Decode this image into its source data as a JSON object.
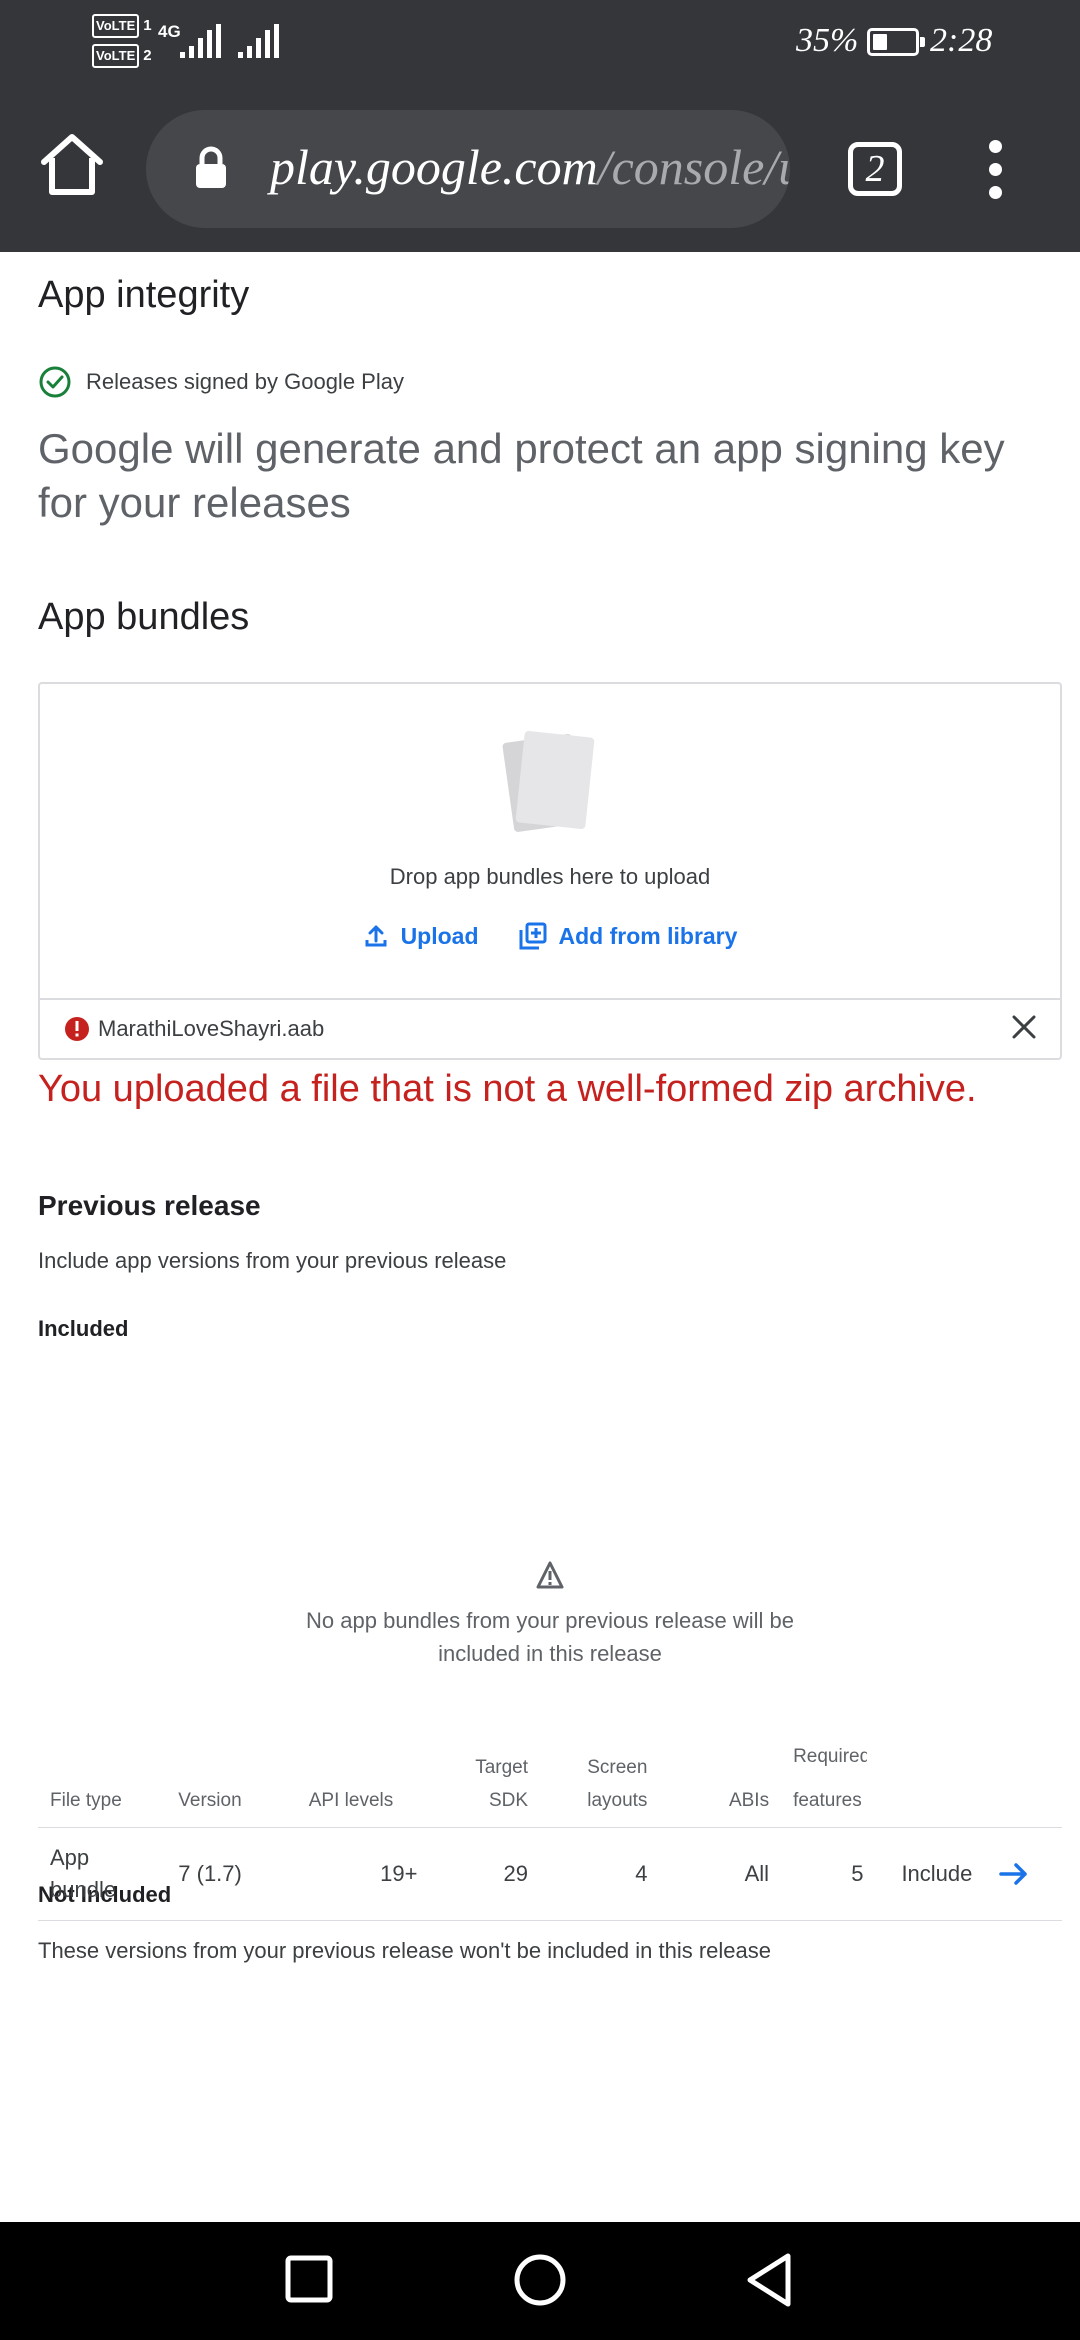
{
  "status_bar": {
    "sim1": "VoLTE",
    "sim1_slot": "1",
    "sim2": "VoLTE",
    "sim2_slot": "2",
    "network": "4G",
    "battery_percent": "35%",
    "battery_level": 0.35,
    "time": "2:28"
  },
  "browser": {
    "url_domain": "play.google.com",
    "url_path": "/console/u",
    "tab_count": "2",
    "icons": [
      "home-icon",
      "lock-icon",
      "tabs-icon",
      "more-vert-icon"
    ]
  },
  "app_integrity": {
    "title": "App integrity",
    "signed_label": "Releases signed by Google Play",
    "description": "Google will generate and protect an app signing key for your releases"
  },
  "app_bundles": {
    "title": "App bundles",
    "drop_text": "Drop app bundles here to upload",
    "upload_label": "Upload",
    "add_from_library_label": "Add from library",
    "file_name": "MarathiLoveShayri.aab",
    "error_message": "You uploaded a file that is not a well-formed zip archive."
  },
  "previous_release": {
    "title": "Previous release",
    "description": "Include app versions from your previous release",
    "included_label": "Included",
    "empty_line1": "No app bundles from your previous release will be",
    "empty_line2": "included in this release",
    "not_included_label": "Not Included",
    "not_included_description": "These versions from your previous release won't be included in this release"
  },
  "table": {
    "headers": {
      "file_type": "File type",
      "version": "Version",
      "api_levels": "API levels",
      "target_sdk_1": "Target",
      "target_sdk_2": "SDK",
      "screen_layouts_1": "Screen",
      "screen_layouts_2": "layouts",
      "abis": "ABIs",
      "required_features_1": "Required",
      "required_features_2": "features"
    },
    "rows": [
      {
        "file_type_1": "App",
        "file_type_2": "bundle",
        "version": "7 (1.7)",
        "api_levels": "19+",
        "target_sdk": "29",
        "screen_layouts": "4",
        "abis": "All",
        "required_features": "5",
        "action": "Include"
      }
    ]
  },
  "colors": {
    "chrome": "#35363a",
    "accent": "#1a73e8",
    "error": "#c5221f",
    "success": "#188038"
  }
}
